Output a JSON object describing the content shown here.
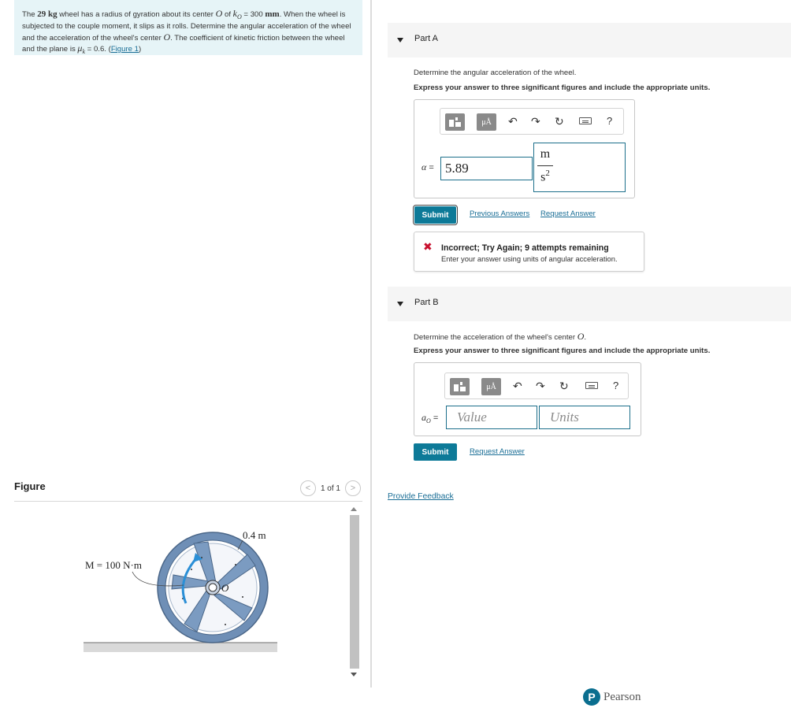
{
  "problem": {
    "mass": "29 kg",
    "text_1": "The ",
    "text_2": " wheel has a radius of gyration about its center ",
    "var_O": "O",
    "text_3": " of ",
    "var_kO": "k",
    "sub_O": "O",
    "text_4": " = 300 ",
    "unit_mm": "mm",
    "text_5": ". When the wheel is subjected to the couple moment, it slips as it rolls. Determine the angular acceleration of the wheel and the acceleration of the wheel's center ",
    "text_6": ". The coefficient of kinetic friction between the wheel and the plane is ",
    "var_mu": "μ",
    "sub_k": "k",
    "text_7": " = 0.6. (",
    "figure_link": "Figure 1",
    "text_8": ")"
  },
  "figure": {
    "title": "Figure",
    "pager_text": "1 of 1",
    "prev_glyph": "<",
    "next_glyph": ">",
    "label_moment": "M = 100 N·m",
    "label_radius": "0.4 m",
    "label_center": "O"
  },
  "part_a": {
    "title": "Part A",
    "prompt": "Determine the angular acceleration of the wheel.",
    "instruction": "Express your answer to three significant figures and include the appropriate units.",
    "var_symbol": "α",
    "equals": " =",
    "value": "5.89",
    "unit_num": "m",
    "unit_den": "s",
    "unit_den_exp": "2",
    "submit": "Submit",
    "previous_answers": "Previous Answers",
    "request_answer": "Request Answer",
    "feedback_mark": "✖",
    "feedback_title": "Incorrect; Try Again; 9 attempts remaining",
    "feedback_message": "Enter your answer using units of angular acceleration."
  },
  "part_b": {
    "title": "Part B",
    "prompt": "Determine the acceleration of the wheel's center ",
    "prompt_var": "O",
    "prompt_end": ".",
    "instruction": "Express your answer to three significant figures and include the appropriate units.",
    "var_symbol": "a",
    "var_sub": "O",
    "equals": " =",
    "value_placeholder": "Value",
    "units_placeholder": "Units",
    "submit": "Submit",
    "request_answer": "Request Answer"
  },
  "toolbar": {
    "templates_label": "▪▫",
    "units_label": "μÅ",
    "undo": "↶",
    "redo": "↷",
    "reset": "↻",
    "help": "?"
  },
  "footer": {
    "provide_feedback": "Provide Feedback",
    "brand_initial": "P",
    "brand_name": "Pearson"
  },
  "colors": {
    "accent": "#0d7a98",
    "problem_bg": "#e6f4f7",
    "error": "#c8102e",
    "wheel": "#7b9bc1"
  }
}
